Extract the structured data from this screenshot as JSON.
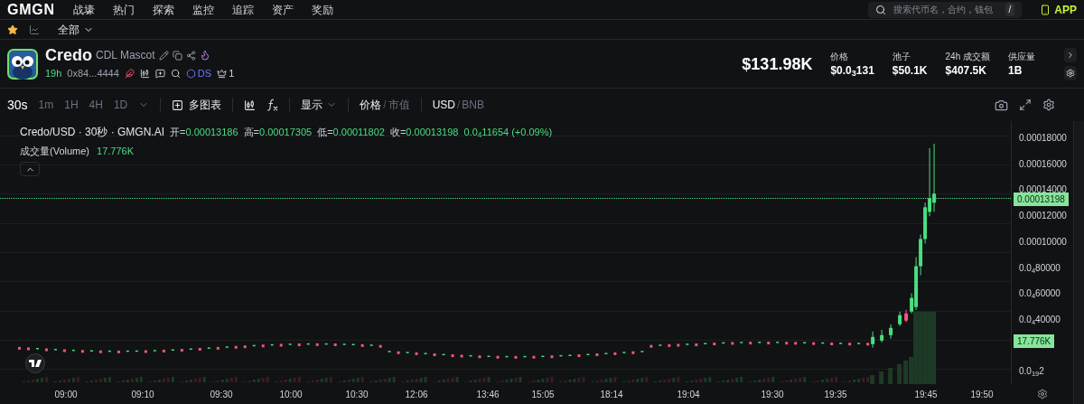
{
  "nav": {
    "logo": "GMGN",
    "items": [
      "战壕",
      "热门",
      "探索",
      "监控",
      "追踪",
      "资产",
      "奖励"
    ],
    "search": {
      "placeholder": "搜索代币名，合约，钱包",
      "shortcut": "/"
    },
    "app": "APP"
  },
  "filter": {
    "starred": true,
    "category": "全部"
  },
  "token": {
    "name": "Credo",
    "subtitle": "CDL Mascot",
    "age": "19h",
    "address": "0x84...4444",
    "ds": "DS",
    "crown_count": "1",
    "market_cap": "$131.98K",
    "stats": [
      {
        "label": "价格",
        "value": "$0.0$_{3}$131"
      },
      {
        "label": "池子",
        "value": "$50.1K"
      },
      {
        "label": "24h 成交额",
        "value": "$407.5K"
      },
      {
        "label": "供应量",
        "value": "1B"
      }
    ]
  },
  "toolbar": {
    "intervals": [
      {
        "label": "30s",
        "selected": true
      },
      {
        "label": "1m",
        "selected": false
      },
      {
        "label": "1H",
        "selected": false
      },
      {
        "label": "4H",
        "selected": false
      },
      {
        "label": "1D",
        "selected": false
      }
    ],
    "multi_chart": "多图表",
    "display": "显示",
    "separator": "/",
    "price_mode": [
      {
        "label": "价格",
        "selected": true
      },
      {
        "label": "市值",
        "selected": false
      }
    ],
    "currency": [
      {
        "label": "USD",
        "selected": true
      },
      {
        "label": "BNB",
        "selected": false
      }
    ]
  },
  "legend": {
    "title": "Credo/USD · 30秒 · GMGN.AI",
    "ohlc": [
      {
        "label": "开=",
        "value": "0.00013186"
      },
      {
        "label": "高=",
        "value": "0.00017305"
      },
      {
        "label": "低=",
        "value": "0.00011802"
      },
      {
        "label": "收=",
        "value": "0.00013198"
      }
    ],
    "change": "0.0$_{4}$11654 (+0.09%)",
    "volume_label": "成交量(Volume)",
    "volume": "17.776K"
  },
  "y_axis": [
    "0.00018000",
    "0.00016000",
    "0.00014000",
    "0.00012000",
    "0.00010000",
    "0.0$_{4}$80000",
    "0.0$_{4}$60000",
    "0.0$_{4}$40000",
    "0.0$_{19}$2"
  ],
  "price_badge": "0.00013198",
  "volume_badge": "17.776K",
  "x_axis": [
    "09:00",
    "09:10",
    "09:30",
    "10:00",
    "10:30",
    "12:06",
    "13:46",
    "15:05",
    "18:14",
    "19:04",
    "19:30",
    "19:35",
    "19:45",
    "19:50"
  ]
}
